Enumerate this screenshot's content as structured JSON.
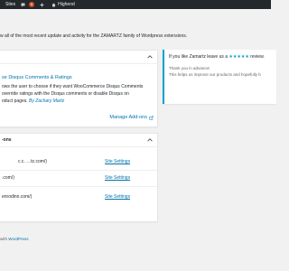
{
  "adminbar": {
    "sites_label": "Sites",
    "notifications_count": "6",
    "site_name": "Highend"
  },
  "intro": "w all of the most recent update and activity for the ZAMARTZ family of Wordpress extensions.",
  "plugin_box": {
    "title": "se Disqus Comments & Ratings",
    "desc_line1": "ows the user to choose if they want WooCommerce Disqus Comments",
    "desc_line2": "override ratings with the Disqus comments or disable Disqus on",
    "desc_line3": "oduct pages.",
    "author": "By Zachary Martz",
    "manage_label": "Manage Add-ons"
  },
  "addons_box": {
    "title": "-ons",
    "rows": [
      {
        "url": "c.c.      …tz.com/)",
        "link": "Site Settings"
      },
      {
        "url": ".com/)",
        "link": "Site Settings"
      },
      {
        "url": "enrodinn.com/)",
        "link": "Site Settings"
      }
    ]
  },
  "notice": {
    "head_prefix": "If you like Zamartz leave us a",
    "stars": "★★★★★",
    "head_suffix": "review.",
    "p1": "Thank you in advance!",
    "p2": "This helps us improve our products and hopefully b"
  },
  "footer": {
    "prefix": "with",
    "link": "WordPress"
  },
  "colors": {
    "link": "#0073aa",
    "accent": "#00a0d2",
    "adminbar": "#23282d",
    "badge": "#d54e21"
  },
  "icons": [
    "speech-bubble-icon",
    "plus-icon",
    "house-icon",
    "external-link-icon",
    "chevron-up-icon"
  ]
}
